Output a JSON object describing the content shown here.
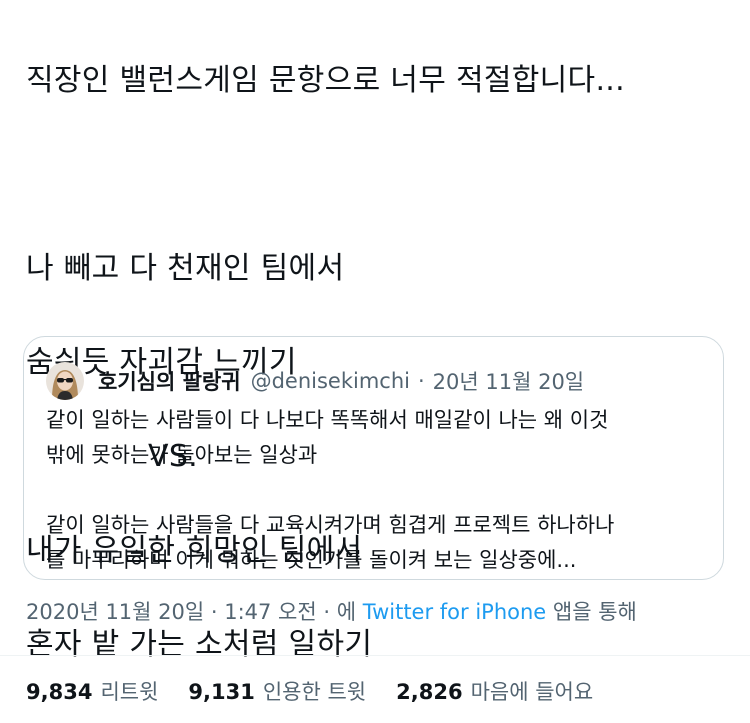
{
  "tweet": {
    "line1": "직장인 밸런스게임 문항으로 너무 적절합니다...",
    "line2": "나 빼고 다 천재인 팀에서",
    "line3": "숨쉬듯 자괴감 느끼기",
    "line4": "VS.",
    "line5": "내가 유일한 희망인 팀에서",
    "line6": "혼자 밭 가는 소처럼 일하기"
  },
  "quote": {
    "name": "호기심의 팔랑귀",
    "handle": "@denisekimchi",
    "separator": "·",
    "date": "20년 11월 20일",
    "body_line1": "같이 일하는 사람들이 다 나보다 똑똑해서 매일같이 나는 왜 이것",
    "body_line2": "밖에 못하는가 돌아보는 일상과",
    "body_line3": "같이 일하는 사람들을 다 교육시켜가며 힘겹게 프로젝트 하나하나",
    "body_line4": "를 마무리하며 이게 뭐하는 짓인가를 돌이켜 보는 일상중에..."
  },
  "meta": {
    "datetime": "2020년 11월 20일 · 1:47 오전 · 에 ",
    "source": "Twitter for iPhone",
    "suffix": " 앱을 통해"
  },
  "stats": {
    "retweets_count": "9,834",
    "retweets_label": "리트윗",
    "quotes_count": "9,131",
    "quotes_label": "인용한 트윗",
    "likes_count": "2,826",
    "likes_label": "마음에 들어요"
  },
  "colors": {
    "text": "#0f1419",
    "secondary": "#536471",
    "link": "#1d9bf0",
    "border": "#cfd9de"
  },
  "icons": {
    "avatar": "user-avatar-sunglasses"
  }
}
